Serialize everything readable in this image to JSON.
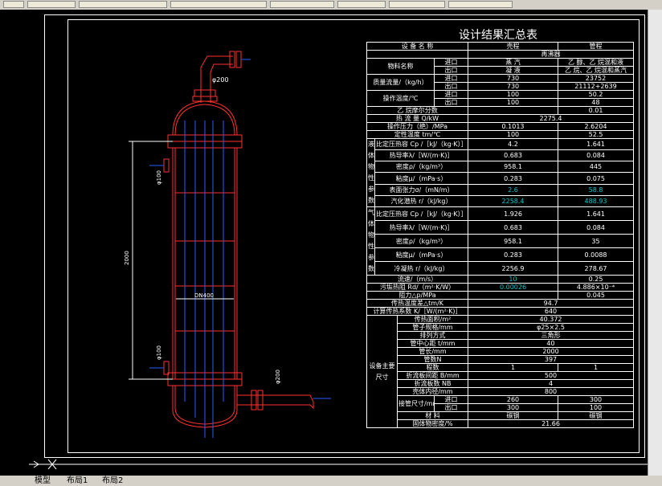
{
  "title": "设计结果汇总表",
  "tabs": [
    "模型",
    "布局1",
    "布局2"
  ],
  "dimensions": {
    "pipe_top": "φ200",
    "nozzle_left_top": "φ100",
    "height": "2000",
    "dn": "DN400",
    "nozzle_left_bottom": "φ100",
    "nozzle_right": "φ200"
  },
  "table": {
    "rows": [
      {
        "cells": [
          "设 备 名 称",
          "壳程",
          "管程"
        ]
      },
      {
        "cells": [
          "",
          "再沸器",
          ""
        ]
      },
      {
        "cells": [
          "物料名称",
          "进口",
          "蒸 汽",
          "乙 醇、乙 烷混和液"
        ]
      },
      {
        "cells": [
          "",
          "出口",
          "凝 液",
          "乙 烷、乙 烷混和蒸汽"
        ]
      },
      {
        "cells": [
          "质量流量/（kg/h）",
          "进口",
          "730",
          "23752"
        ]
      },
      {
        "cells": [
          "",
          "出口",
          "730",
          "21112+2639"
        ]
      },
      {
        "cells": [
          "操作温度/℃",
          "进口",
          "100",
          "50.2"
        ]
      },
      {
        "cells": [
          "",
          "出口",
          "100",
          "48"
        ]
      },
      {
        "cells": [
          "乙 烷摩尔分数",
          "",
          "0.01"
        ]
      },
      {
        "cells": [
          "热 流 量  Q/kW",
          "2275.4"
        ]
      },
      {
        "cells": [
          "操作压力（绝）/MPa",
          "0.1013",
          "2.6204"
        ]
      },
      {
        "cells": [
          "定性温度 tm/℃",
          "100",
          "52.5"
        ]
      },
      {
        "cells": [
          "比定压热容 Cp /［kJ/（kg·K）］",
          "4.2",
          "1.641"
        ]
      },
      {
        "cells": [
          "热导率λ/［W/(m·K)］",
          "0.683",
          "0.084"
        ]
      },
      {
        "cells": [
          "密度ρ/（kg/m³）",
          "958.1",
          "445"
        ]
      },
      {
        "cells": [
          "粘度μ/（mPa·s）",
          "0.283",
          "0.075"
        ]
      },
      {
        "cells": [
          "表面张力σ/（mN/m）",
          "2.6",
          "58.8"
        ]
      },
      {
        "cells": [
          "汽化潜热 r/（kJ/kg）",
          "2258.4",
          "488.93"
        ]
      },
      {
        "cells": [
          "比定压热容 Cp /［kJ/（kg·K）］",
          "1.926",
          "1.641"
        ]
      },
      {
        "cells": [
          "热导率λ/［W/(m·K)］",
          "0.683",
          "0.084"
        ]
      },
      {
        "cells": [
          "密度ρ/（kg/m³）",
          "958.1",
          "35"
        ]
      },
      {
        "cells": [
          "粘度μ/（mPa·s）",
          "0.283",
          "0.0088"
        ]
      },
      {
        "cells": [
          "冷凝热 r/（kJ/kg）",
          "2256.9",
          "278.67"
        ]
      },
      {
        "cells": [
          "流速/（m/s）",
          "10",
          "0.25"
        ]
      },
      {
        "cells": [
          "污垢热阻 Rd/（m²·K/W）",
          "0.00026",
          "4.886×10⁻⁴"
        ]
      },
      {
        "cells": [
          "阻力△p/MPa",
          "",
          "0.045"
        ]
      },
      {
        "cells": [
          "传热温度差△tm/K",
          "94.7"
        ]
      },
      {
        "cells": [
          "计算传热系数 K/［W/(m²·K)］",
          "640"
        ]
      },
      {
        "cells": [
          "传热面积/m²",
          "40.372"
        ]
      },
      {
        "cells": [
          "管子规格/mm",
          "φ25×2.5"
        ]
      },
      {
        "cells": [
          "排列方式",
          "三角形"
        ]
      },
      {
        "cells": [
          "管中心距 t/mm",
          "40"
        ]
      },
      {
        "cells": [
          "管长/mm",
          "2000"
        ]
      },
      {
        "cells": [
          "管数N",
          "397"
        ]
      },
      {
        "cells": [
          "程数",
          "1",
          "1"
        ]
      },
      {
        "cells": [
          "折流板间距 B/mm",
          "500"
        ]
      },
      {
        "cells": [
          "折流板数 NB",
          "4"
        ]
      },
      {
        "cells": [
          "壳体内径/mm",
          "800"
        ]
      },
      {
        "cells": [
          "接管尺寸/mm",
          "进口",
          "260",
          "300"
        ]
      },
      {
        "cells": [
          "",
          "出口",
          "300",
          "100"
        ]
      },
      {
        "cells": [
          "材  料",
          "碳钢",
          "碳钢"
        ]
      },
      {
        "cells": [
          "固体物密度/%",
          "21.66"
        ]
      }
    ],
    "side_liquid": "液体物性参数",
    "side_gas": "气体物性参数",
    "side_equipment": "设备主要尺寸"
  }
}
